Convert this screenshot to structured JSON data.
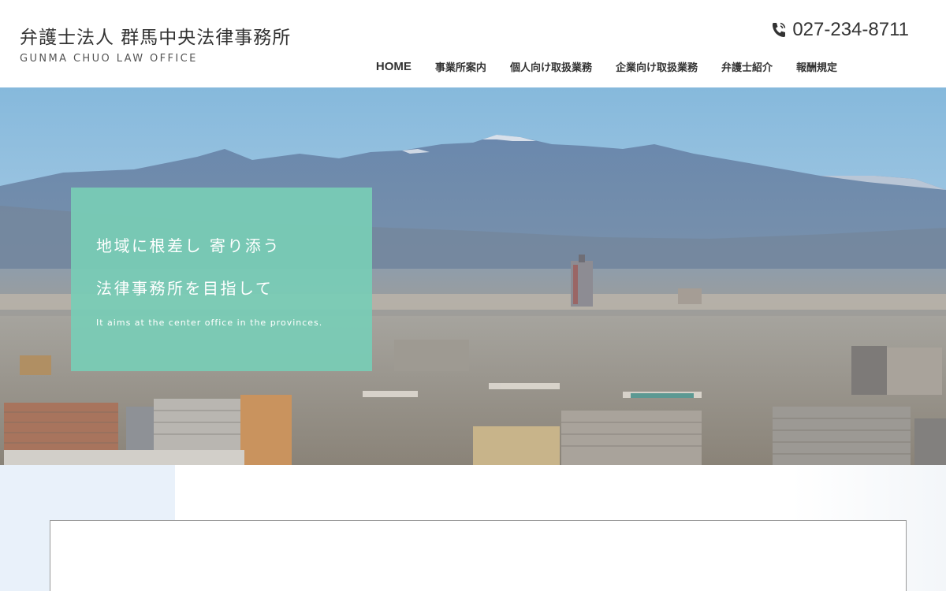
{
  "header": {
    "logo_jp": "弁護士法人 群馬中央法律事務所",
    "logo_en": "GUNMA CHUO LAW OFFICE",
    "phone": "027-234-8711",
    "phone_icon": "phone-icon"
  },
  "nav": [
    {
      "label": "HOME"
    },
    {
      "label": "事業所案内"
    },
    {
      "label": "個人向け取扱業務"
    },
    {
      "label": "企業向け取扱業務"
    },
    {
      "label": "弁護士紹介"
    },
    {
      "label": "報酬規定"
    }
  ],
  "hero": {
    "line1": "地域に根差し 寄り添う",
    "line2": "法律事務所を目指して",
    "subtitle": "It aims at the center office in the provinces."
  },
  "colors": {
    "accent": "#78ccb6",
    "sky": "#8fbfdd",
    "mountain": "#5f7ea3",
    "panel": "#e9f1fa"
  }
}
